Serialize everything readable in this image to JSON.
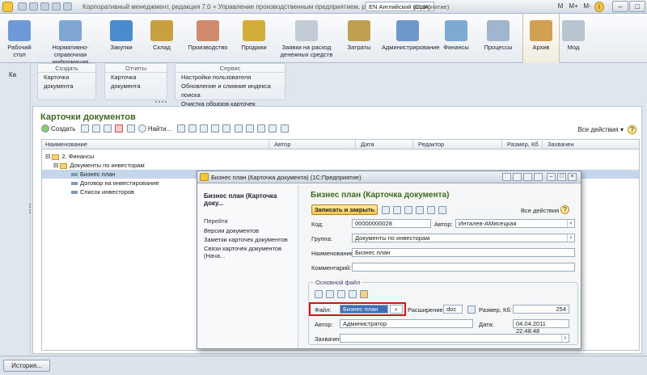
{
  "window": {
    "title": "Корпоративный менеджмент, редакция 7.0 + Управление производственным предприятием, редакция 1.3",
    "lang": "EN Английский (США)",
    "lang_extra": "редприятие)",
    "m1": "M",
    "m2": "M+",
    "m3": "M-",
    "info": "i"
  },
  "sections": [
    {
      "label": "Рабочий стол",
      "color": "#6d9ad6"
    },
    {
      "label": "Нормативно-справочная информация",
      "color": "#7fa6d2"
    },
    {
      "label": "Закупки",
      "color": "#4a8bd0"
    },
    {
      "label": "Склад",
      "color": "#c9a040"
    },
    {
      "label": "Производство",
      "color": "#d08b6e"
    },
    {
      "label": "Продажи",
      "color": "#d2ad38"
    },
    {
      "label": "Заявки на расход денежных средств",
      "color": "#c3ccd6"
    },
    {
      "label": "Затраты",
      "color": "#bfa050"
    },
    {
      "label": "Администрирование",
      "color": "#6f98c9"
    },
    {
      "label": "Финансы",
      "color": "#7fa8d3"
    },
    {
      "label": "Процессы",
      "color": "#9fb6ce"
    },
    {
      "label": "Архив",
      "color": "#d1a053"
    },
    {
      "label": "Мод",
      "color": "#b8c4d0"
    }
  ],
  "leftstrip": {
    "label": "Ка"
  },
  "groups": [
    {
      "title": "Создать",
      "items": [
        "Карточка документа"
      ]
    },
    {
      "title": "Отчеты",
      "items": [
        "Карточка документа"
      ]
    },
    {
      "title": "Сервис",
      "items": [
        "Настройки пользователя",
        "Обновление и слияние индекса поиска",
        "Очистка образов карточек"
      ]
    }
  ],
  "main": {
    "title": "Карточки документов",
    "create": "Создать",
    "find": "Найти...",
    "all_actions": "Все действия",
    "help": "?",
    "columns": [
      "Наименование",
      "Автор",
      "Дата",
      "Редактор",
      "Размер, Кб",
      "Захвачен"
    ],
    "rows": [
      {
        "label": "2. Финансы",
        "level": 0,
        "kind": "folder"
      },
      {
        "label": "Документы по инвесторам",
        "level": 1,
        "kind": "folder"
      },
      {
        "label": "Бизнес план",
        "level": 2,
        "kind": "doc"
      },
      {
        "label": "Договор на инвестирование",
        "level": 2,
        "kind": "doc"
      },
      {
        "label": "Список инвесторов",
        "level": 2,
        "kind": "doc"
      }
    ]
  },
  "dialog": {
    "title": "Бизнес план (Карточка документа)  (1С:Предприятие)",
    "side_title": "Бизнес план (Карточка доку...",
    "go": "Перейти",
    "links": [
      "Версии документов",
      "Заметки карточек документов",
      "Связи карточек документов (Нача..."
    ],
    "header": "Бизнес план (Карточка документа)",
    "save": "Записать и закрыть",
    "all_actions": "Все действия",
    "help": "?",
    "code_label": "Код:",
    "code": "00000000028",
    "author_label": "Автор:",
    "author": "Инталев-AMисецкая",
    "group_label": "Группа:",
    "group": "Документы по инвесторам",
    "name_label": "Наименование:",
    "name": "Бизнес план",
    "comment_label": "Комментарий:",
    "comment": "",
    "file_group": "Основной файл",
    "file_label": "Файл:",
    "file": "Бизнес план",
    "ext_label": "Расширение:",
    "ext": "doc",
    "size_label": "Размер, Кб:",
    "size": "254",
    "fauthor_label": "Автор:",
    "fauthor": "Администратор",
    "date_label": "Дата:",
    "date": "04.04.2011 22:48:48",
    "captured_label": "Захвачен:",
    "captured": ""
  },
  "bottom": {
    "history": "История..."
  }
}
